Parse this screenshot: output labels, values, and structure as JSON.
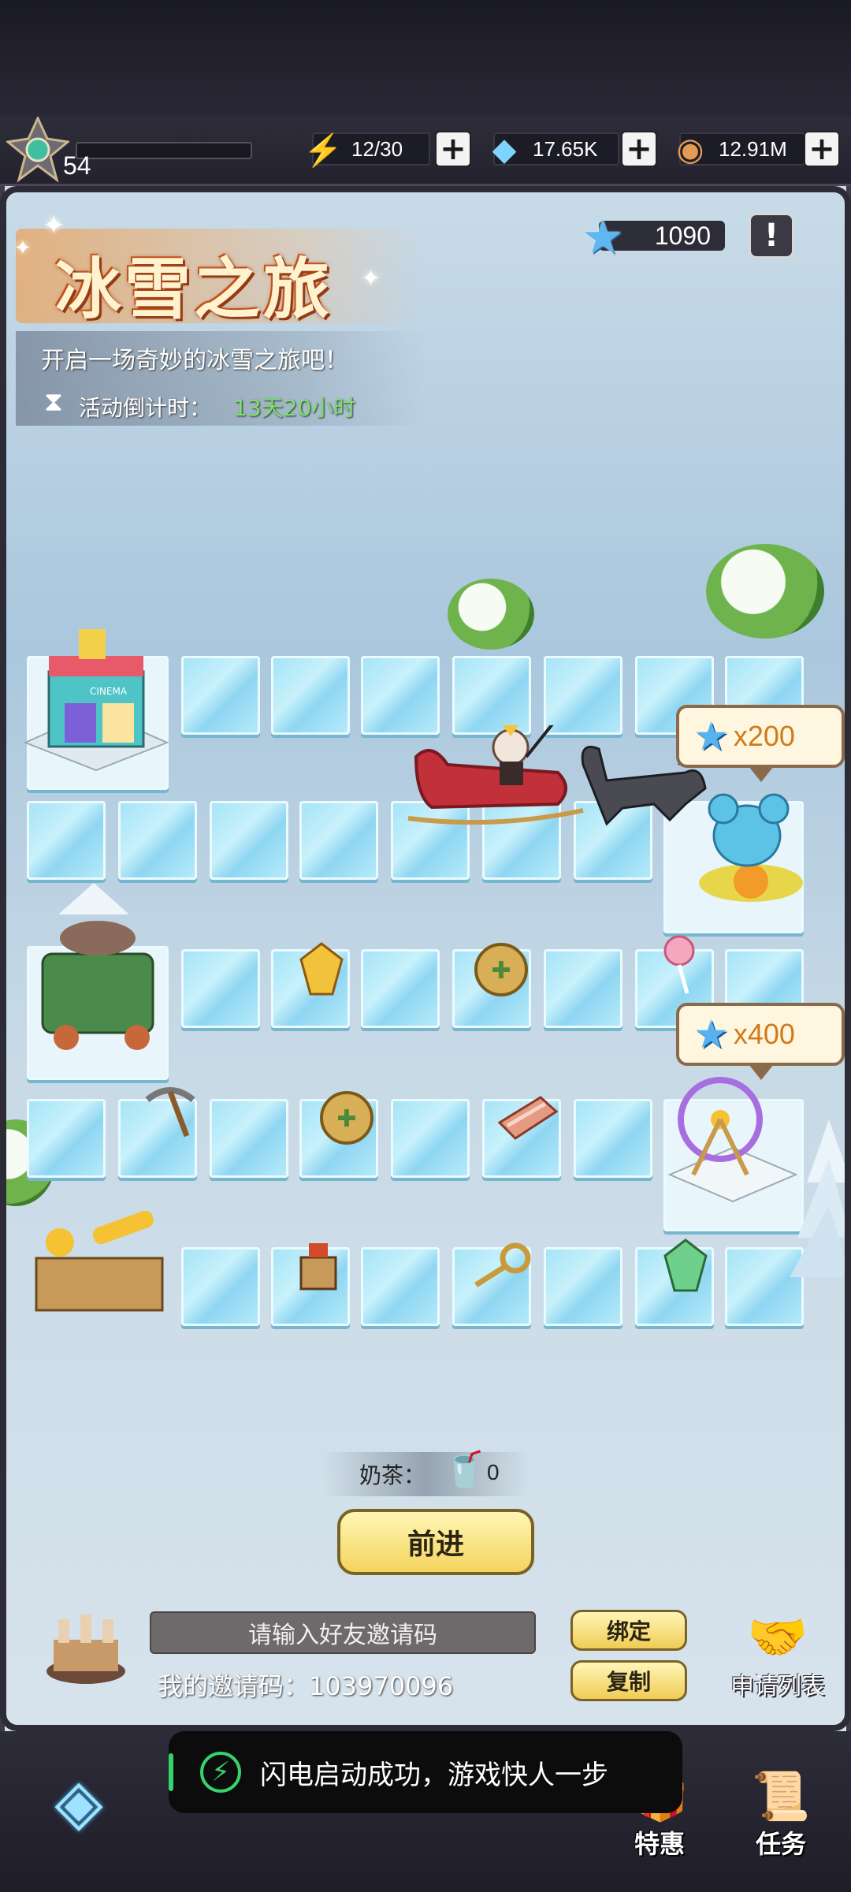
{
  "player": {
    "level": "54"
  },
  "resources": {
    "energy": {
      "icon": "lightning-icon",
      "value": "12/30"
    },
    "gems": {
      "icon": "diamond-icon",
      "value": "17.65K"
    },
    "coins": {
      "icon": "coin-icon",
      "value": "12.91M"
    }
  },
  "event": {
    "title": "冰雪之旅",
    "subtitle": "开启一场奇妙的冰雪之旅吧！",
    "countdown_label": "活动倒计时：",
    "countdown_value": "13天20小时",
    "stars": "1090"
  },
  "rewards": [
    {
      "label": "x200",
      "icon": "star-icon"
    },
    {
      "label": "x400",
      "icon": "star-icon"
    }
  ],
  "buildings": {
    "cinema_sign": "CINEMA"
  },
  "milk_tea": {
    "label": "奶茶：",
    "count": "0"
  },
  "actions": {
    "advance": "前进"
  },
  "invite": {
    "placeholder": "请输入好友邀请码",
    "my_code_label": "我的邀请码：",
    "my_code": "103970096",
    "bind": "绑定",
    "copy": "复制",
    "apply_list": "申请列表"
  },
  "nav": {
    "special": "特惠",
    "tasks": "任务"
  },
  "toast": {
    "text": "闪电启动成功，游戏快人一步"
  },
  "colors": {
    "accent_green": "#36d36a",
    "star_blue": "#5fb7f2",
    "button_yellow": "#f4d45e"
  }
}
